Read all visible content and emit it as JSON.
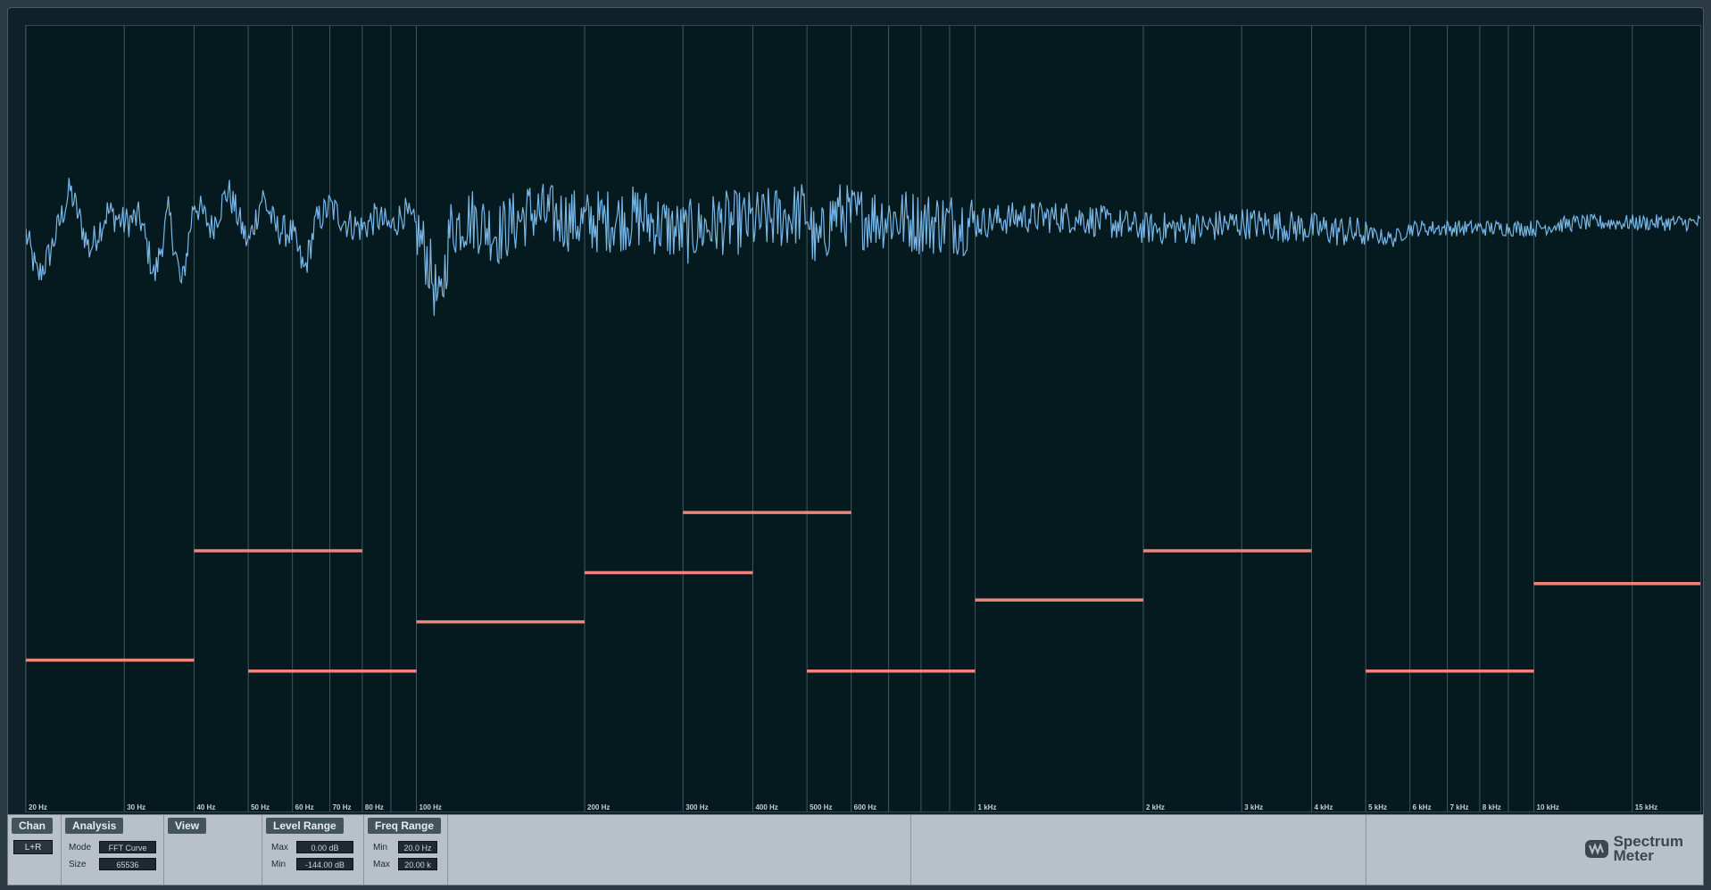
{
  "chart_data": {
    "type": "line",
    "x_scale": "log",
    "xlim": [
      20,
      20000
    ],
    "ylim": [
      -144,
      0
    ],
    "x_ticks": [
      {
        "value": 20,
        "label": "20 Hz"
      },
      {
        "value": 30,
        "label": "30 Hz"
      },
      {
        "value": 40,
        "label": "40 Hz"
      },
      {
        "value": 50,
        "label": "50 Hz"
      },
      {
        "value": 60,
        "label": "60 Hz"
      },
      {
        "value": 70,
        "label": "70 Hz"
      },
      {
        "value": 80,
        "label": "80 Hz"
      },
      {
        "value": 100,
        "label": "100 Hz"
      },
      {
        "value": 200,
        "label": "200 Hz"
      },
      {
        "value": 300,
        "label": "300 Hz"
      },
      {
        "value": 400,
        "label": "400 Hz"
      },
      {
        "value": 500,
        "label": "500 Hz"
      },
      {
        "value": 600,
        "label": "600 Hz"
      },
      {
        "value": 1000,
        "label": "1 kHz"
      },
      {
        "value": 2000,
        "label": "2 kHz"
      },
      {
        "value": 3000,
        "label": "3 kHz"
      },
      {
        "value": 4000,
        "label": "4 kHz"
      },
      {
        "value": 5000,
        "label": "5 kHz"
      },
      {
        "value": 6000,
        "label": "6 kHz"
      },
      {
        "value": 7000,
        "label": "7 kHz"
      },
      {
        "value": 8000,
        "label": "8 kHz"
      },
      {
        "value": 10000,
        "label": "10 kHz"
      },
      {
        "value": 15000,
        "label": "15 kHz"
      }
    ],
    "gridlines": [
      20,
      30,
      40,
      50,
      60,
      70,
      80,
      90,
      100,
      200,
      300,
      400,
      500,
      600,
      700,
      800,
      900,
      1000,
      2000,
      3000,
      4000,
      5000,
      6000,
      7000,
      8000,
      9000,
      10000,
      15000,
      20000
    ],
    "spectrum_series": {
      "color": "#79b7e8",
      "points": [
        [
          20,
          -38
        ],
        [
          21,
          -46
        ],
        [
          22,
          -42
        ],
        [
          24,
          -30
        ],
        [
          26,
          -41
        ],
        [
          28,
          -34
        ],
        [
          30,
          -36
        ],
        [
          32,
          -35
        ],
        [
          34,
          -46
        ],
        [
          36,
          -34
        ],
        [
          38,
          -48
        ],
        [
          40,
          -32
        ],
        [
          43,
          -37
        ],
        [
          46,
          -30
        ],
        [
          50,
          -40
        ],
        [
          53,
          -31
        ],
        [
          56,
          -37
        ],
        [
          60,
          -38
        ],
        [
          63,
          -45
        ],
        [
          66,
          -36
        ],
        [
          70,
          -33
        ],
        [
          75,
          -36
        ],
        [
          80,
          -37
        ],
        [
          85,
          -35
        ],
        [
          90,
          -37
        ],
        [
          95,
          -34
        ],
        [
          100,
          -37
        ],
        [
          105,
          -43
        ],
        [
          110,
          -52
        ],
        [
          115,
          -37
        ],
        [
          125,
          -35
        ],
        [
          140,
          -38
        ],
        [
          160,
          -34
        ],
        [
          200,
          -36
        ],
        [
          250,
          -35
        ],
        [
          300,
          -38
        ],
        [
          350,
          -36
        ],
        [
          400,
          -36
        ],
        [
          450,
          -35
        ],
        [
          500,
          -34
        ],
        [
          520,
          -41
        ],
        [
          560,
          -34
        ],
        [
          600,
          -35
        ],
        [
          700,
          -35
        ],
        [
          800,
          -36
        ],
        [
          1000,
          -36
        ],
        [
          1200,
          -35
        ],
        [
          1500,
          -35
        ],
        [
          2000,
          -37
        ],
        [
          2500,
          -37
        ],
        [
          3000,
          -36
        ],
        [
          4000,
          -37
        ],
        [
          5000,
          -38
        ],
        [
          5600,
          -39
        ],
        [
          6000,
          -37
        ],
        [
          7000,
          -37
        ],
        [
          8000,
          -37
        ],
        [
          10000,
          -37
        ],
        [
          12000,
          -36
        ],
        [
          15000,
          -36
        ],
        [
          20000,
          -36
        ]
      ]
    },
    "band_markers": {
      "color": "#f0847c",
      "segments": [
        {
          "f_start": 20,
          "f_end": 40,
          "level": -116
        },
        {
          "f_start": 40,
          "f_end": 80,
          "level": -96
        },
        {
          "f_start": 50,
          "f_end": 100,
          "level": -118
        },
        {
          "f_start": 100,
          "f_end": 200,
          "level": -109
        },
        {
          "f_start": 200,
          "f_end": 400,
          "level": -100
        },
        {
          "f_start": 300,
          "f_end": 600,
          "level": -89
        },
        {
          "f_start": 500,
          "f_end": 1000,
          "level": -118
        },
        {
          "f_start": 1000,
          "f_end": 2000,
          "level": -105
        },
        {
          "f_start": 2000,
          "f_end": 4000,
          "level": -96
        },
        {
          "f_start": 5000,
          "f_end": 10000,
          "level": -118
        },
        {
          "f_start": 10000,
          "f_end": 20000,
          "level": -102
        }
      ]
    }
  },
  "panel": {
    "chan": {
      "title": "Chan",
      "button": "L+R"
    },
    "analysis": {
      "title": "Analysis",
      "mode_label": "Mode",
      "mode_value": "FFT Curve",
      "size_label": "Size",
      "size_value": "65536"
    },
    "view": {
      "title": "View"
    },
    "level_range": {
      "title": "Level Range",
      "max_label": "Max",
      "max_value": "0.00 dB",
      "min_label": "Min",
      "min_value": "-144.00 dB"
    },
    "freq_range": {
      "title": "Freq Range",
      "min_label": "Min",
      "min_value": "20.0 Hz",
      "max_label": "Max",
      "max_value": "20.00 k"
    },
    "logo": {
      "line1": "Spectrum",
      "line2": "Meter"
    }
  }
}
